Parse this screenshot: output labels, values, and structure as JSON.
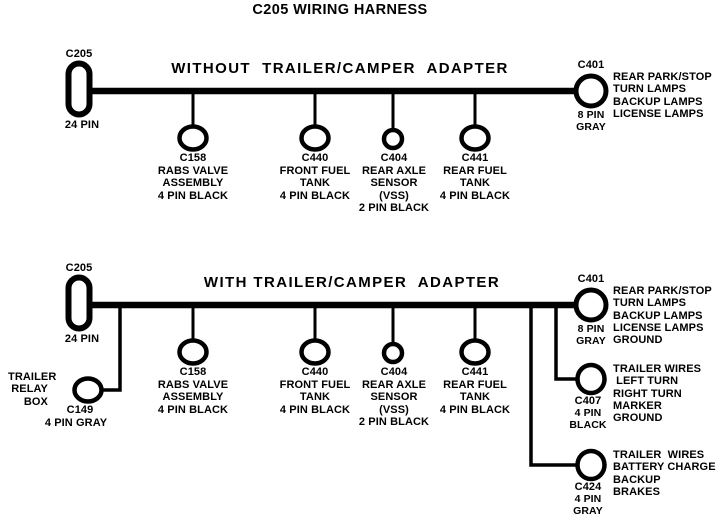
{
  "title": "C205 WIRING HARNESS",
  "diagrams": [
    {
      "id": "without-adapter",
      "heading": "WITHOUT  TRAILER/CAMPER  ADAPTER",
      "source": {
        "id": "C205",
        "pins": "24 PIN",
        "icon": "rounded-rect-connector"
      },
      "terminal": {
        "id": "C401",
        "pins": "8 PIN",
        "color_label": "GRAY",
        "icon": "circle-connector",
        "descriptions": [
          "REAR PARK/STOP",
          "TURN LAMPS",
          "BACKUP LAMPS",
          "LICENSE LAMPS"
        ]
      },
      "branches": [
        {
          "id": "C158",
          "lines": [
            "RABS VALVE",
            "ASSEMBLY",
            "4 PIN BLACK"
          ],
          "icon": "ellipse-connector"
        },
        {
          "id": "C440",
          "lines": [
            "FRONT FUEL",
            "TANK",
            "4 PIN BLACK"
          ],
          "icon": "ellipse-connector"
        },
        {
          "id": "C404",
          "lines": [
            "REAR AXLE",
            "SENSOR",
            "(VSS)",
            "2 PIN BLACK"
          ],
          "icon": "small-circle-connector"
        },
        {
          "id": "C441",
          "lines": [
            "REAR FUEL",
            "TANK",
            "4 PIN BLACK"
          ],
          "icon": "ellipse-connector"
        }
      ]
    },
    {
      "id": "with-adapter",
      "heading": "WITH TRAILER/CAMPER  ADAPTER",
      "source": {
        "id": "C205",
        "pins": "24 PIN",
        "icon": "rounded-rect-connector"
      },
      "terminal": {
        "id": "C401",
        "pins": "8 PIN",
        "color_label": "GRAY",
        "icon": "circle-connector",
        "descriptions": [
          "REAR PARK/STOP",
          "TURN LAMPS",
          "BACKUP LAMPS",
          "LICENSE LAMPS",
          "GROUND"
        ]
      },
      "relay": {
        "name_lines": [
          "TRAILER",
          "RELAY",
          "BOX"
        ],
        "id": "C149",
        "pins": "4 PIN GRAY",
        "icon": "ellipse-connector"
      },
      "branches": [
        {
          "id": "C158",
          "lines": [
            "RABS VALVE",
            "ASSEMBLY",
            "4 PIN BLACK"
          ],
          "icon": "ellipse-connector"
        },
        {
          "id": "C440",
          "lines": [
            "FRONT FUEL",
            "TANK",
            "4 PIN BLACK"
          ],
          "icon": "ellipse-connector"
        },
        {
          "id": "C404",
          "lines": [
            "REAR AXLE",
            "SENSOR",
            "(VSS)",
            "2 PIN BLACK"
          ],
          "icon": "small-circle-connector"
        },
        {
          "id": "C441",
          "lines": [
            "REAR FUEL",
            "TANK",
            "4 PIN BLACK"
          ],
          "icon": "ellipse-connector"
        }
      ],
      "adapter_outputs": [
        {
          "id": "C407",
          "spec_lines": [
            "4 PIN",
            "BLACK"
          ],
          "icon": "ellipse-connector",
          "descriptions": [
            "TRAILER WIRES",
            " LEFT TURN",
            "RIGHT TURN",
            "MARKER",
            "GROUND"
          ]
        },
        {
          "id": "C424",
          "spec_lines": [
            "4 PIN",
            "GRAY"
          ],
          "icon": "ellipse-connector",
          "descriptions": [
            "TRAILER  WIRES",
            "BATTERY CHARGE",
            "BACKUP",
            "BRAKES"
          ]
        }
      ]
    }
  ],
  "colors": {
    "line": "#000000",
    "background": "#ffffff",
    "text": "#000000"
  }
}
